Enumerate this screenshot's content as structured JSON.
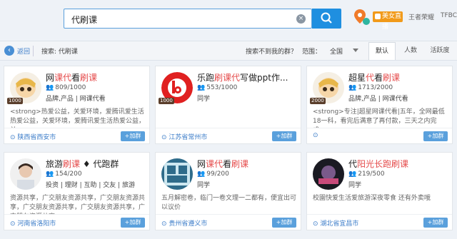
{
  "search": {
    "value": "代刷课",
    "clear_icon": "×"
  },
  "topright": {
    "live_label": "美女直播",
    "user": "王者荣耀",
    "tag": "TFBC"
  },
  "nav": {
    "back_label": "返回",
    "search_label": "搜索: 代刷课",
    "not_found": "搜索不到我的群？",
    "scope_label": "范围：",
    "scope_value": "全国"
  },
  "tabs": [
    {
      "label": "默认"
    },
    {
      "label": "人数"
    },
    {
      "label": "活跃度"
    }
  ],
  "cards": [
    {
      "name_pre": "网",
      "name_hl": "课代",
      "name_mid": "看",
      "name_hl2": "刷课",
      "name_post": "",
      "count": "809/1000",
      "tags": "品牌,产品 | 网课代看",
      "desc": "<strong>热爱公益，关爱环境，爱腾讯爱生活热爱公益，关爱环境，爱腾讯爱生活热爱公益，关",
      "location": "陕西省西安市",
      "level": "1000",
      "add": "+加群"
    },
    {
      "name_pre": "乐跑",
      "name_hl": "刷课代",
      "name_mid": "写做ppt作...",
      "name_hl2": "",
      "name_post": "",
      "count": "553/1000",
      "tags": "同学",
      "desc": "",
      "location": "江苏省常州市",
      "level": "1000",
      "add": "+加群"
    },
    {
      "name_pre": "超星",
      "name_hl": "代",
      "name_mid": "看",
      "name_hl2": "刷课",
      "name_post": "",
      "count": "1713/2000",
      "tags": "品牌,产品 | 网课代看",
      "desc": "<strong>专注|超星网课代看|五年，全网最低18一科，看完后满意了再付款，三天之内完成，",
      "location": "",
      "level": "2000",
      "add": "+加群"
    },
    {
      "name_pre": "旅游",
      "name_hl": "刷课",
      "name_mid": "代跑群",
      "name_hl2": "",
      "name_post": "",
      "count": "154/200",
      "tags": "投资 | 理财 | 互助 | 交友 | 旅游",
      "desc": "资源共享，广交朋友资源共享，广交朋友资源共享，广交朋友资源共享，广交朋友资源共享，广交朋友资源共享，",
      "location": "河南省洛阳市",
      "level": "",
      "add": "+加群"
    },
    {
      "name_pre": "网",
      "name_hl": "课代",
      "name_mid": "看",
      "name_hl2": "刷课",
      "name_post": "",
      "count": "99/200",
      "tags": "同学",
      "desc": "五月解密卷，临门一卷文理一二都有，便宜出可以议价",
      "location": "贵州省遵义市",
      "level": "",
      "add": "+加群"
    },
    {
      "name_pre": "代",
      "name_hl": "阳光长跑",
      "name_mid": "",
      "name_hl2": "刷课",
      "name_post": "",
      "count": "219/500",
      "tags": "同学",
      "desc": "校園快爱生活爱旅游深夜零食 还有外卖哦",
      "location": "湖北省宜昌市",
      "level": "",
      "add": "+加群"
    }
  ]
}
